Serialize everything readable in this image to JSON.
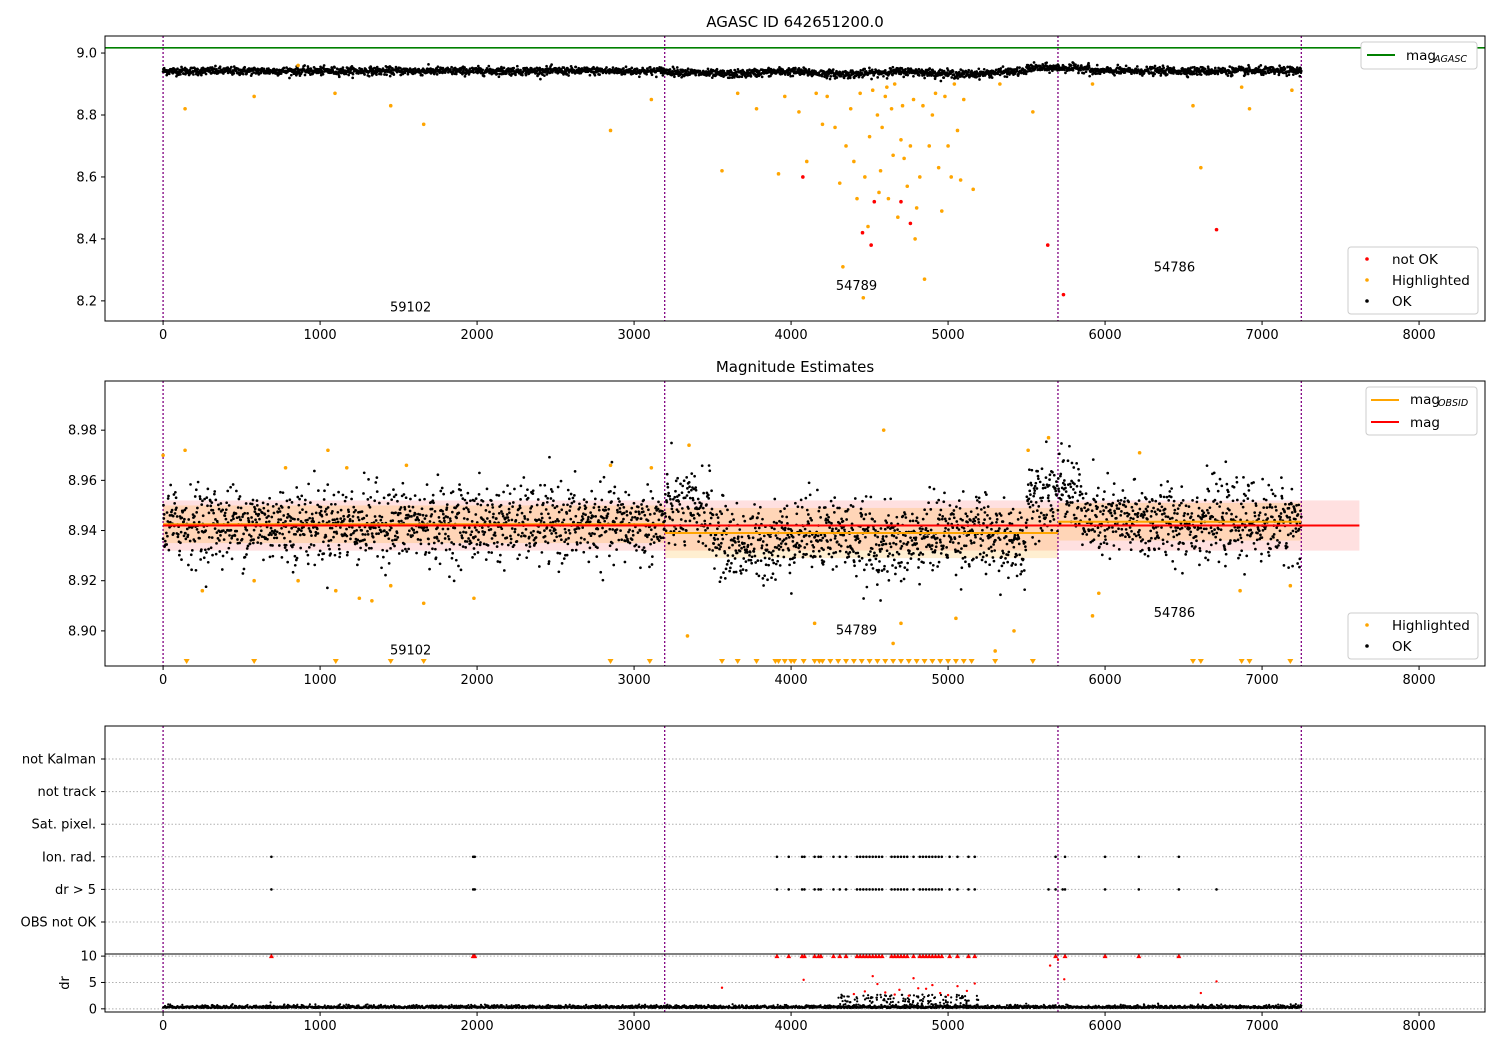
{
  "chart_data": [
    {
      "type": "scatter",
      "title": "AGASC ID 642651200.0",
      "xlim": [
        -370,
        8420
      ],
      "ylim": [
        8.135,
        9.055
      ],
      "xticks": [
        0,
        1000,
        2000,
        3000,
        4000,
        5000,
        6000,
        7000,
        8000
      ],
      "yticks": [
        8.2,
        8.4,
        8.6,
        8.8,
        9.0
      ],
      "vlines": [
        0,
        3195,
        5700,
        7250
      ],
      "hline": {
        "name": "mag_AGASC",
        "y": 9.017,
        "color": "#008000"
      },
      "legend": {
        "position": "upper right",
        "entries": [
          "mag",
          "AGASC"
        ]
      },
      "legend2": {
        "position": "lower right",
        "entries": [
          "not OK",
          "Highlighted",
          "OK"
        ]
      },
      "ok_band": {
        "x_range": [
          0,
          7250
        ],
        "y_center": 8.942,
        "y_spread": 0.012
      },
      "series": [
        {
          "name": "not OK",
          "color": "#ff0000",
          "points": [
            [
              4075,
              8.6
            ],
            [
              4455,
              8.42
            ],
            [
              4510,
              8.38
            ],
            [
              4530,
              8.52
            ],
            [
              4700,
              8.52
            ],
            [
              4760,
              8.45
            ],
            [
              5635,
              8.38
            ],
            [
              5735,
              8.22
            ],
            [
              6710,
              8.43
            ]
          ]
        },
        {
          "name": "Highlighted",
          "color": "#ffa500",
          "points": [
            [
              140,
              8.82
            ],
            [
              580,
              8.86
            ],
            [
              860,
              8.96
            ],
            [
              1095,
              8.87
            ],
            [
              1450,
              8.83
            ],
            [
              1660,
              8.77
            ],
            [
              2850,
              8.75
            ],
            [
              3110,
              8.85
            ],
            [
              3560,
              8.62
            ],
            [
              3660,
              8.87
            ],
            [
              3780,
              8.82
            ],
            [
              3920,
              8.61
            ],
            [
              3960,
              8.86
            ],
            [
              4050,
              8.81
            ],
            [
              4100,
              8.65
            ],
            [
              4160,
              8.87
            ],
            [
              4200,
              8.77
            ],
            [
              4230,
              8.86
            ],
            [
              4280,
              8.76
            ],
            [
              4310,
              8.58
            ],
            [
              4330,
              8.31
            ],
            [
              4350,
              8.7
            ],
            [
              4380,
              8.82
            ],
            [
              4400,
              8.65
            ],
            [
              4420,
              8.53
            ],
            [
              4440,
              8.87
            ],
            [
              4460,
              8.21
            ],
            [
              4470,
              8.6
            ],
            [
              4490,
              8.44
            ],
            [
              4500,
              8.73
            ],
            [
              4520,
              8.88
            ],
            [
              4550,
              8.8
            ],
            [
              4560,
              8.55
            ],
            [
              4570,
              8.62
            ],
            [
              4580,
              8.76
            ],
            [
              4600,
              8.86
            ],
            [
              4610,
              8.89
            ],
            [
              4620,
              8.53
            ],
            [
              4640,
              8.82
            ],
            [
              4650,
              8.67
            ],
            [
              4660,
              8.9
            ],
            [
              4680,
              8.47
            ],
            [
              4700,
              8.72
            ],
            [
              4710,
              8.83
            ],
            [
              4720,
              8.66
            ],
            [
              4740,
              8.57
            ],
            [
              4760,
              8.7
            ],
            [
              4780,
              8.85
            ],
            [
              4790,
              8.4
            ],
            [
              4800,
              8.5
            ],
            [
              4820,
              8.6
            ],
            [
              4840,
              8.83
            ],
            [
              4850,
              8.27
            ],
            [
              4880,
              8.7
            ],
            [
              4900,
              8.8
            ],
            [
              4920,
              8.87
            ],
            [
              4940,
              8.63
            ],
            [
              4960,
              8.49
            ],
            [
              4980,
              8.86
            ],
            [
              5000,
              8.7
            ],
            [
              5020,
              8.6
            ],
            [
              5040,
              8.9
            ],
            [
              5060,
              8.75
            ],
            [
              5080,
              8.59
            ],
            [
              5100,
              8.85
            ],
            [
              5160,
              8.56
            ],
            [
              5330,
              8.9
            ],
            [
              5540,
              8.81
            ],
            [
              5920,
              8.9
            ],
            [
              6560,
              8.83
            ],
            [
              6610,
              8.63
            ],
            [
              6870,
              8.89
            ],
            [
              6920,
              8.82
            ],
            [
              7190,
              8.88
            ]
          ]
        },
        {
          "name": "OK",
          "color": "#000000",
          "summary": "dense band 0–7250"
        }
      ],
      "annotations": [
        {
          "text": "59102",
          "x": 1445,
          "y": 8.165
        },
        {
          "text": "54789",
          "x": 4285,
          "y": 8.235
        },
        {
          "text": "54786",
          "x": 6310,
          "y": 8.295
        }
      ]
    },
    {
      "type": "scatter",
      "title": "Magnitude Estimates",
      "xlim": [
        -370,
        8420
      ],
      "ylim": [
        8.886,
        8.9996
      ],
      "xticks": [
        0,
        1000,
        2000,
        3000,
        4000,
        5000,
        6000,
        7000,
        8000
      ],
      "yticks": [
        8.9,
        8.92,
        8.94,
        8.96,
        8.98
      ],
      "vlines": [
        0,
        3195,
        5700,
        7250
      ],
      "mag_line": {
        "name": "mag",
        "y": 8.942,
        "x_range": [
          0,
          7620
        ],
        "band": [
          8.932,
          8.952
        ],
        "color": "#ff0000"
      },
      "mag_obsid": [
        {
          "x_range": [
            0,
            3195
          ],
          "y": 8.9425,
          "band": [
            8.935,
            8.95
          ]
        },
        {
          "x_range": [
            3195,
            5700
          ],
          "y": 8.939,
          "band": [
            8.929,
            8.949
          ]
        },
        {
          "x_range": [
            5700,
            7250
          ],
          "y": 8.9435,
          "band": [
            8.936,
            8.951
          ]
        }
      ],
      "legend": {
        "position": "upper right",
        "entries": [
          "mag",
          "OBSID",
          "mag"
        ]
      },
      "legend2": {
        "position": "lower right",
        "entries": [
          "Highlighted",
          "OK"
        ]
      },
      "series": [
        {
          "name": "Highlighted",
          "color": "#ffa500",
          "points": [
            [
              0,
              8.97
            ],
            [
              140,
              8.972
            ],
            [
              250,
              8.916
            ],
            [
              580,
              8.92
            ],
            [
              780,
              8.965
            ],
            [
              860,
              8.92
            ],
            [
              1050,
              8.972
            ],
            [
              1100,
              8.916
            ],
            [
              1170,
              8.965
            ],
            [
              1250,
              8.913
            ],
            [
              1330,
              8.912
            ],
            [
              1450,
              8.918
            ],
            [
              1550,
              8.966
            ],
            [
              1660,
              8.911
            ],
            [
              1980,
              8.913
            ],
            [
              2850,
              8.966
            ],
            [
              3110,
              8.965
            ],
            [
              3340,
              8.898
            ],
            [
              3350,
              8.974
            ],
            [
              4150,
              8.903
            ],
            [
              4590,
              8.98
            ],
            [
              4650,
              8.895
            ],
            [
              4700,
              8.903
            ],
            [
              5050,
              8.905
            ],
            [
              5300,
              8.892
            ],
            [
              5420,
              8.9
            ],
            [
              5510,
              8.972
            ],
            [
              5640,
              8.977
            ],
            [
              5920,
              8.906
            ],
            [
              5960,
              8.915
            ],
            [
              6220,
              8.971
            ],
            [
              6860,
              8.916
            ],
            [
              7180,
              8.918
            ]
          ]
        },
        {
          "name": "OK",
          "color": "#000000",
          "summary": "dense band 0–7250"
        }
      ],
      "triangles_x": [
        150,
        580,
        1100,
        1450,
        1660,
        2850,
        3100,
        3560,
        3660,
        3780,
        3900,
        3920,
        3960,
        4000,
        4020,
        4080,
        4150,
        4180,
        4200,
        4250,
        4300,
        4350,
        4400,
        4450,
        4500,
        4550,
        4600,
        4650,
        4700,
        4750,
        4800,
        4850,
        4900,
        4950,
        5000,
        5050,
        5100,
        5150,
        5300,
        5540,
        6560,
        6610,
        6870,
        6920,
        7180
      ],
      "annotations": [
        {
          "text": "59102",
          "x": 1445,
          "y": 8.8905
        },
        {
          "text": "54789",
          "x": 4285,
          "y": 8.8985
        },
        {
          "text": "54786",
          "x": 6310,
          "y": 8.9055
        }
      ]
    },
    {
      "type": "scatter",
      "title": "",
      "xlim": [
        -370,
        8420
      ],
      "xticks": [
        0,
        1000,
        2000,
        3000,
        4000,
        5000,
        6000,
        7000,
        8000
      ],
      "vlines": [
        0,
        3195,
        5700,
        7250
      ],
      "flag_rows": [
        "not Kalman",
        "not track",
        "Sat. pixel.",
        "Ion. rad.",
        "dr > 5",
        "OBS not OK"
      ],
      "flags": {
        "Ion. rad.": [
          690,
          1975,
          1985,
          3910,
          3985,
          4070,
          4085,
          4150,
          4175,
          4190,
          4270,
          4310,
          4350,
          4420,
          4440,
          4460,
          4480,
          4500,
          4520,
          4540,
          4560,
          4580,
          4640,
          4660,
          4680,
          4700,
          4720,
          4740,
          4780,
          4820,
          4840,
          4860,
          4880,
          4900,
          4920,
          4940,
          4960,
          5010,
          5060,
          5130,
          5170,
          5685,
          5745,
          6000,
          6215,
          6470
        ],
        "dr > 5": [
          690,
          1975,
          1985,
          3910,
          3985,
          4070,
          4085,
          4150,
          4175,
          4190,
          4270,
          4310,
          4350,
          4420,
          4440,
          4460,
          4480,
          4500,
          4520,
          4540,
          4560,
          4580,
          4640,
          4660,
          4680,
          4700,
          4720,
          4740,
          4780,
          4820,
          4840,
          4860,
          4880,
          4900,
          4920,
          4940,
          4960,
          5010,
          5060,
          5130,
          5170,
          5640,
          5685,
          5730,
          5745,
          6000,
          6215,
          6470,
          6710
        ]
      },
      "dr": {
        "ylabel": "dr",
        "yticks": [
          0,
          5,
          10
        ],
        "ylim": [
          -0.6,
          10.4
        ],
        "clipped_at_10_x": [
          690,
          1975,
          1985,
          3910,
          3985,
          4070,
          4085,
          4150,
          4175,
          4190,
          4270,
          4310,
          4350,
          4420,
          4440,
          4460,
          4480,
          4500,
          4520,
          4540,
          4560,
          4580,
          4640,
          4660,
          4680,
          4700,
          4720,
          4740,
          4780,
          4820,
          4840,
          4860,
          4880,
          4900,
          4920,
          4940,
          4960,
          5010,
          5060,
          5130,
          5170,
          5685,
          5745,
          6000,
          6215,
          6470
        ],
        "red_points": [
          [
            3560,
            4.0
          ],
          [
            4080,
            5.5
          ],
          [
            4400,
            2.8
          ],
          [
            4470,
            3.3
          ],
          [
            4520,
            6.2
          ],
          [
            4550,
            4.7
          ],
          [
            4600,
            3.1
          ],
          [
            4660,
            2.7
          ],
          [
            4690,
            3.6
          ],
          [
            4750,
            2.5
          ],
          [
            4780,
            5.8
          ],
          [
            4810,
            3.9
          ],
          [
            4860,
            3.8
          ],
          [
            4900,
            4.5
          ],
          [
            4950,
            3.0
          ],
          [
            5000,
            2.6
          ],
          [
            5060,
            4.3
          ],
          [
            5120,
            3.4
          ],
          [
            5170,
            4.8
          ],
          [
            5650,
            8.2
          ],
          [
            5700,
            9.3
          ],
          [
            5740,
            5.6
          ],
          [
            6610,
            3.0
          ],
          [
            6710,
            5.2
          ]
        ],
        "black_band": {
          "x_range": [
            0,
            7250
          ],
          "y_max": 0.7
        }
      }
    }
  ]
}
